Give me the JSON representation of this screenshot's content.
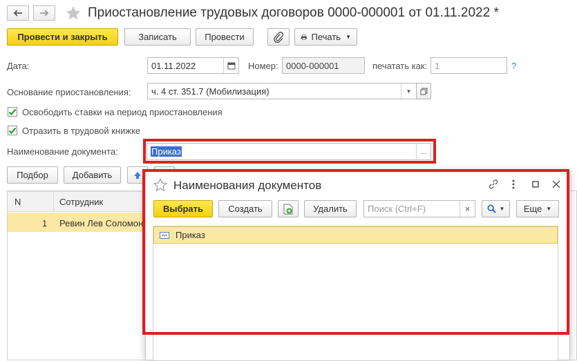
{
  "form": {
    "title": "Приостановление трудовых договоров 0000-000001 от 01.11.2022 *",
    "toolbar": {
      "post_close": "Провести и закрыть",
      "save": "Записать",
      "post": "Провести",
      "print": "Печать"
    },
    "date_label": "Дата:",
    "date_value": "01.11.2022",
    "number_label": "Номер:",
    "number_value": "0000-000001",
    "print_as_label": "печатать как:",
    "print_as_value": "1",
    "help": "?",
    "basis_label": "Основание приостановления:",
    "basis_value": "ч. 4 ст. 351.7 (Мобилизация)",
    "release_rates_label": "Освободить ставки на период приостановления",
    "workbook_label": "Отразить в трудовой книжке",
    "docname_label": "Наименование документа:",
    "docname_value": "Приказ",
    "ellipsis": "...",
    "table_toolbar": {
      "select": "Подбор",
      "add": "Добавить"
    },
    "table": {
      "columns": [
        "N",
        "Сотрудник"
      ],
      "rows": [
        {
          "n": "1",
          "employee": "Ревин Лев Соломон"
        }
      ]
    }
  },
  "dialog": {
    "title": "Наименования документов",
    "toolbar": {
      "choose": "Выбрать",
      "create": "Создать",
      "delete": "Удалить",
      "search_placeholder": "Поиск (Ctrl+F)",
      "clear": "×",
      "more": "Еще"
    },
    "items": [
      {
        "label": "Приказ"
      }
    ]
  },
  "colors": {
    "accent_yellow": "#f4cf17",
    "highlight_frame": "#e01e1e",
    "selected_row": "#fbe8a4",
    "help": "#2a7bd4"
  }
}
